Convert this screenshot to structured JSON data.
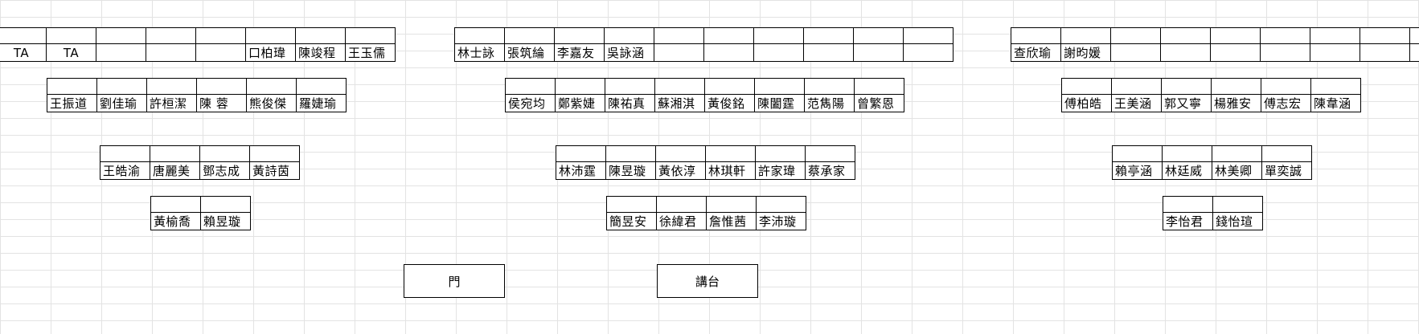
{
  "groups": [
    {
      "id": "left-row1",
      "names": [
        "TA",
        "TA",
        "",
        "",
        "",
        "口柏瑋",
        "陳竣程",
        "王玉儒"
      ]
    },
    {
      "id": "left-row2",
      "names": [
        "王振道",
        "劉佳瑜",
        "許桓潔",
        "陳 蓉",
        "熊俊傑",
        "羅婕瑜"
      ]
    },
    {
      "id": "left-row3",
      "names": [
        "王皓渝",
        "唐麗美",
        "鄧志成",
        "黃詩茵"
      ]
    },
    {
      "id": "left-row4",
      "names": [
        "黃榆喬",
        "賴昱璇"
      ]
    },
    {
      "id": "center-row1",
      "names": [
        "林士詠",
        "張筑綸",
        "李嘉友",
        "吳詠涵",
        "",
        "",
        "",
        "",
        "",
        ""
      ]
    },
    {
      "id": "center-row2",
      "names": [
        "侯宛均",
        "鄭紫婕",
        "陳祐真",
        "蘇湘淇",
        "黃俊銘",
        "陳闔霆",
        "范雋陽",
        "曾繁恩"
      ]
    },
    {
      "id": "center-row3",
      "names": [
        "林沛霆",
        "陳昱璇",
        "黃依淳",
        "林琪軒",
        "許家瑋",
        "蔡承家"
      ]
    },
    {
      "id": "center-row4",
      "names": [
        "簡昱安",
        "徐緯君",
        "詹惟茜",
        "李沛璇"
      ]
    },
    {
      "id": "right-row1",
      "names": [
        "查欣瑜",
        "謝昀媛",
        "",
        "",
        "",
        "",
        "",
        "",
        ""
      ]
    },
    {
      "id": "right-row2",
      "names": [
        "傅柏皓",
        "王美涵",
        "郭又寧",
        "楊雅安",
        "傅志宏",
        "陳韋涵"
      ]
    },
    {
      "id": "right-row3",
      "names": [
        "賴亭涵",
        "林廷威",
        "林美卿",
        "單奕誠"
      ]
    },
    {
      "id": "right-row4",
      "names": [
        "李怡君",
        "錢怡瑄"
      ]
    }
  ],
  "labels": {
    "door": "門",
    "podium": "講台"
  }
}
